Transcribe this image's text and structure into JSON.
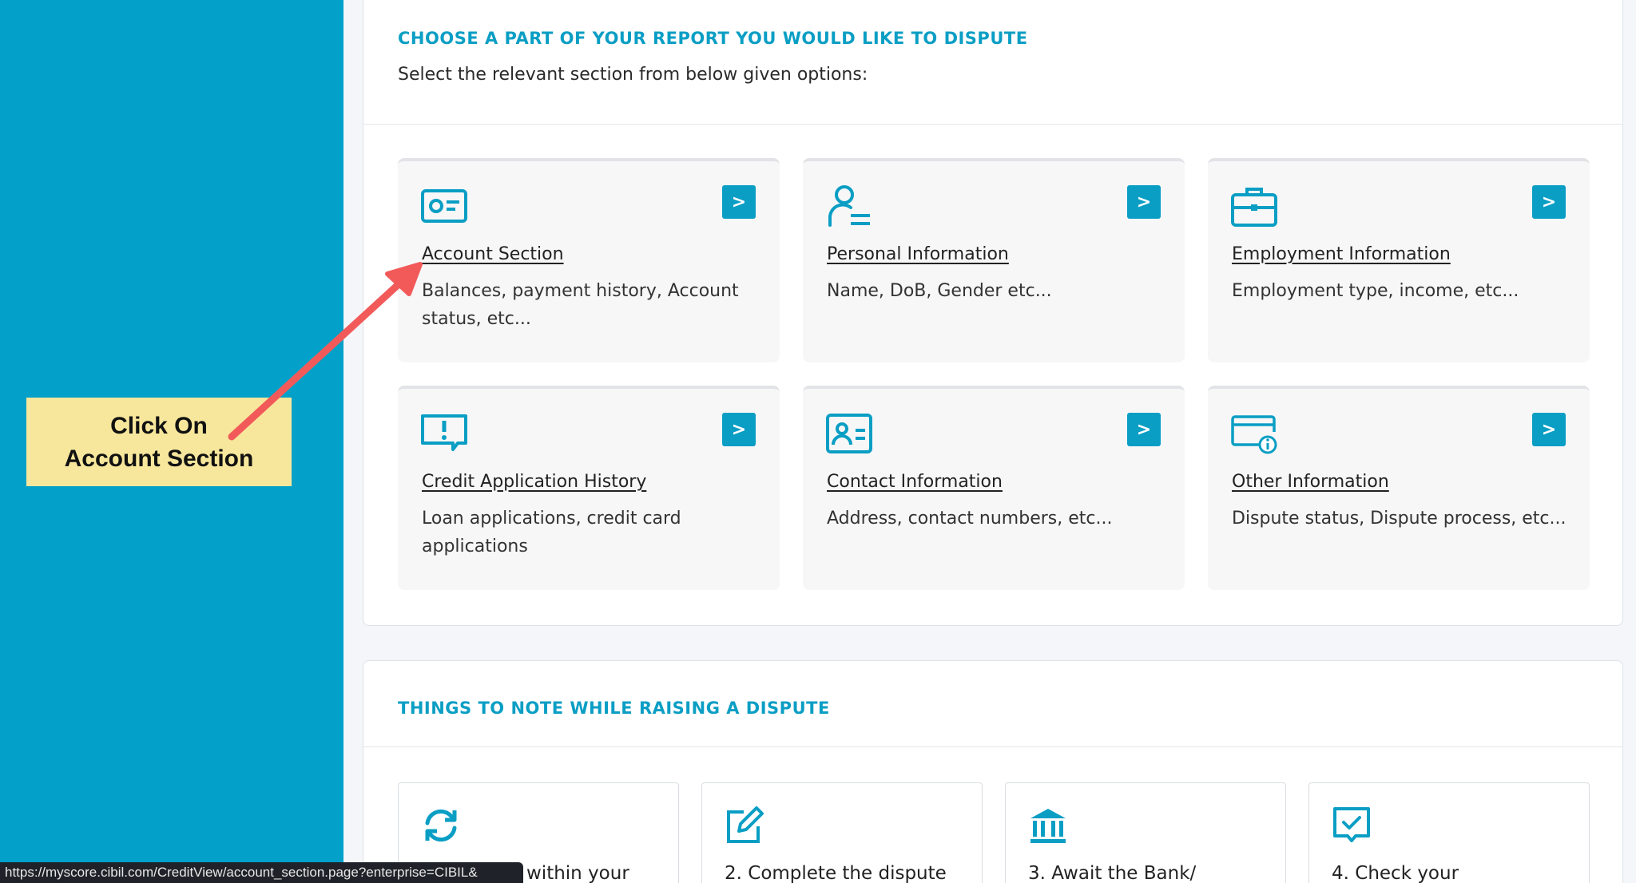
{
  "callout": {
    "line1": "Click On",
    "line2": "Account Section"
  },
  "dispute_panel": {
    "title": "CHOOSE A PART OF YOUR REPORT YOU WOULD LIKE TO DISPUTE",
    "subtitle": "Select the relevant section from below given options:",
    "cards": [
      {
        "icon": "id-card-icon",
        "title": "Account Section",
        "desc": "Balances, payment history, Account status, etc..."
      },
      {
        "icon": "person-list-icon",
        "title": "Personal Information",
        "desc": "Name, DoB, Gender etc..."
      },
      {
        "icon": "briefcase-icon",
        "title": "Employment Information",
        "desc": "Employment type, income, etc..."
      },
      {
        "icon": "alert-message-icon",
        "title": "Credit Application History",
        "desc": "Loan applications, credit card applications"
      },
      {
        "icon": "contact-card-icon",
        "title": "Contact Information",
        "desc": "Address, contact numbers, etc..."
      },
      {
        "icon": "card-info-icon",
        "title": "Other Information",
        "desc": "Dispute status, Dispute process, etc..."
      }
    ],
    "chevron": ">"
  },
  "notes_panel": {
    "title": "THINGS TO NOTE WHILE RAISING A DISPUTE",
    "items": [
      {
        "icon": "refresh-icon",
        "text": "within your"
      },
      {
        "icon": "edit-icon",
        "text": "2. Complete the dispute"
      },
      {
        "icon": "bank-icon",
        "text": "3. Await the Bank/"
      },
      {
        "icon": "checkbox-message-icon",
        "text": "4. Check your"
      }
    ]
  },
  "status_bar": {
    "url": "https://myscore.cibil.com/CreditView/account_section.page?enterprise=CIBIL&"
  },
  "colors": {
    "sidebar": "#03a1c9",
    "accent": "#0a9ec4",
    "callout": "#f7e79c",
    "arrow": "#f25a5a"
  }
}
